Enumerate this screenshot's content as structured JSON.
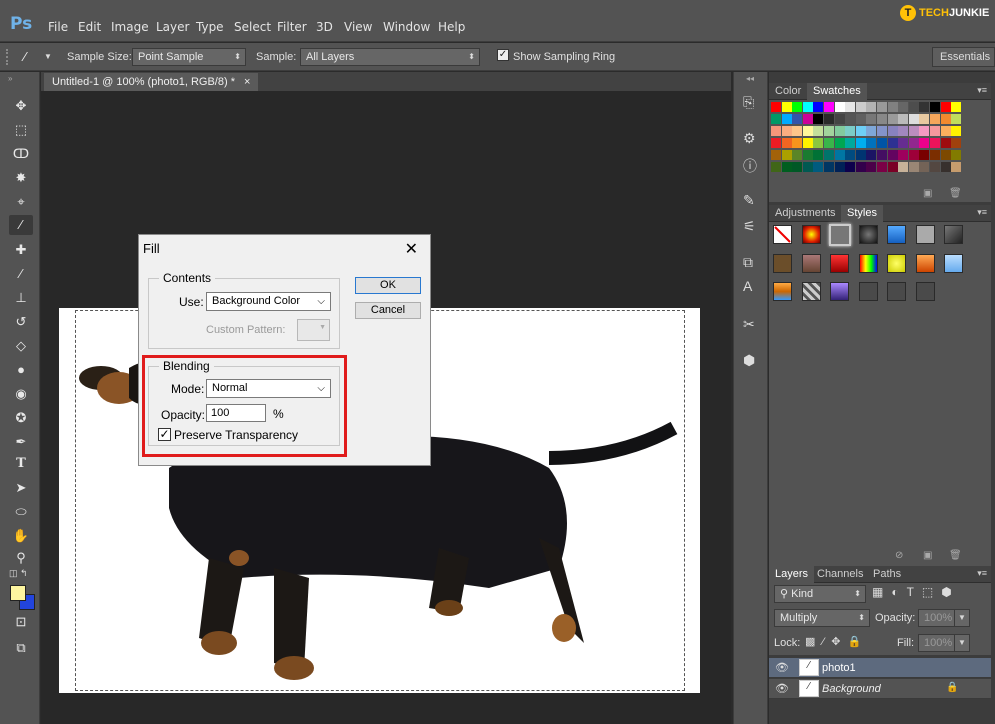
{
  "app_logo": "Ps",
  "menu": [
    "File",
    "Edit",
    "Image",
    "Layer",
    "Type",
    "Select",
    "Filter",
    "3D",
    "View",
    "Window",
    "Help"
  ],
  "brand": {
    "part1": "TECH",
    "part2": "JUNKIE",
    "icon": "T"
  },
  "options": {
    "sample_size_label": "Sample Size:",
    "sample_size_value": "Point Sample",
    "sample_label": "Sample:",
    "sample_value": "All Layers",
    "sampling_ring_label": "Show Sampling Ring",
    "sampling_ring_checked": true,
    "workspace": "Essentials"
  },
  "document_tab": {
    "title": "Untitled-1 @ 100% (photo1, RGB/8) *",
    "close": "×"
  },
  "panels": {
    "top_tabs": [
      "Color",
      "Swatches"
    ],
    "mid_tabs": [
      "Adjustments",
      "Styles"
    ],
    "layers_tabs": [
      "Layers",
      "Channels",
      "Paths"
    ]
  },
  "swatch_colors": [
    [
      "#ff0000",
      "#ffff00",
      "#00ff00",
      "#00ffff",
      "#0000ff",
      "#ff00ff",
      "#ffffff",
      "#e6e6e6",
      "#cccccc",
      "#b3b3b3",
      "#999999",
      "#808080",
      "#666666",
      "#4d4d4d",
      "#333333",
      "#000000",
      "#ff0000",
      "#ffff00"
    ],
    [
      "#009966",
      "#00aaff",
      "#3355aa",
      "#cc0099",
      "#000000",
      "#2a2a2a",
      "#444444",
      "#555555",
      "#606060",
      "#777777",
      "#888888",
      "#9a9a9a",
      "#bbbbbb",
      "#dddddd",
      "#e8c9a0",
      "#f5a65b",
      "#f28a2e",
      "#c1dd5c"
    ],
    [
      "#f7977a",
      "#f9ad81",
      "#fdc68a",
      "#fff79a",
      "#c4df9b",
      "#a2d39c",
      "#82ca9d",
      "#7bcdc8",
      "#6ecff6",
      "#7ea7d8",
      "#8493ca",
      "#8882be",
      "#a187be",
      "#bc8dbf",
      "#f49ac2",
      "#f6989d",
      "#fbaf5d",
      "#fff200"
    ],
    [
      "#ed1c24",
      "#f26522",
      "#f7941d",
      "#fff200",
      "#8dc73f",
      "#39b54a",
      "#00a651",
      "#00a99d",
      "#00aeef",
      "#0072bc",
      "#0054a6",
      "#2e3192",
      "#662d91",
      "#92278f",
      "#ec008c",
      "#ed145b",
      "#9e0b0f",
      "#a0410d"
    ],
    [
      "#a36209",
      "#aba000",
      "#598527",
      "#1a7b30",
      "#007236",
      "#00746b",
      "#0076a3",
      "#004b80",
      "#003471",
      "#1b1464",
      "#440e62",
      "#630460",
      "#9e005d",
      "#9e0039",
      "#790000",
      "#7b2e00",
      "#7d4900",
      "#827b00"
    ],
    [
      "#406618",
      "#005e20",
      "#005826",
      "#005952",
      "#005b7f",
      "#003663",
      "#002157",
      "#0d004c",
      "#32004b",
      "#4b0049",
      "#7b0046",
      "#7a0026",
      "#c7b299",
      "#998675",
      "#736357",
      "#534741",
      "#37302d",
      "#c69c6d"
    ]
  ],
  "styles": {
    "row1": [
      "none",
      "red-glow",
      "selected",
      "black",
      "blue",
      "gray",
      "dark"
    ],
    "row2": [
      "brown",
      "tan",
      "red",
      "multi",
      "yellow",
      "orange",
      "sky"
    ],
    "row3": [
      "sunset",
      "pattern",
      "purple",
      "empty",
      "empty",
      "empty"
    ]
  },
  "fill_dialog": {
    "title": "Fill",
    "close": "✕",
    "contents_label": "Contents",
    "use_label": "Use:",
    "use_value": "Background Color",
    "custom_pattern_label": "Custom Pattern:",
    "blending_label": "Blending",
    "mode_label": "Mode:",
    "mode_value": "Normal",
    "opacity_label": "Opacity:",
    "opacity_value": "100",
    "percent": "%",
    "preserve_label": "Preserve Transparency",
    "preserve_checked": true,
    "ok": "OK",
    "cancel": "Cancel"
  },
  "layers": {
    "kind_label": "Kind",
    "blend_mode": "Multiply",
    "opacity_label": "Opacity:",
    "opacity_value": "100%",
    "lock_label": "Lock:",
    "fill_label": "Fill:",
    "fill_value": "100%",
    "items": [
      {
        "name": "photo1",
        "selected": true
      },
      {
        "name": "Background",
        "selected": false
      }
    ]
  }
}
